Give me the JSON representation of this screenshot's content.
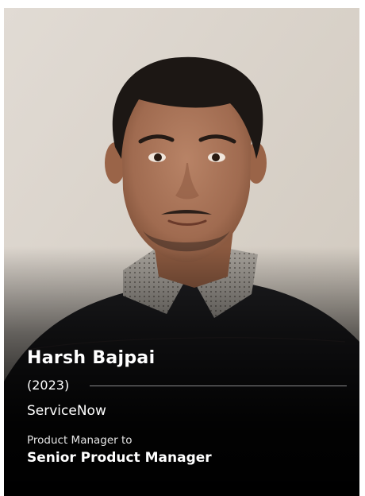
{
  "profile": {
    "name": "Harsh Bajpai",
    "year": "(2023)",
    "company": "ServiceNow",
    "from_role": "Product Manager to",
    "to_role": "Senior Product Manager"
  },
  "colors": {
    "background": "#d8d2c9",
    "overlay": "#000000",
    "text": "#ffffff",
    "divider": "#8c8c8c"
  }
}
